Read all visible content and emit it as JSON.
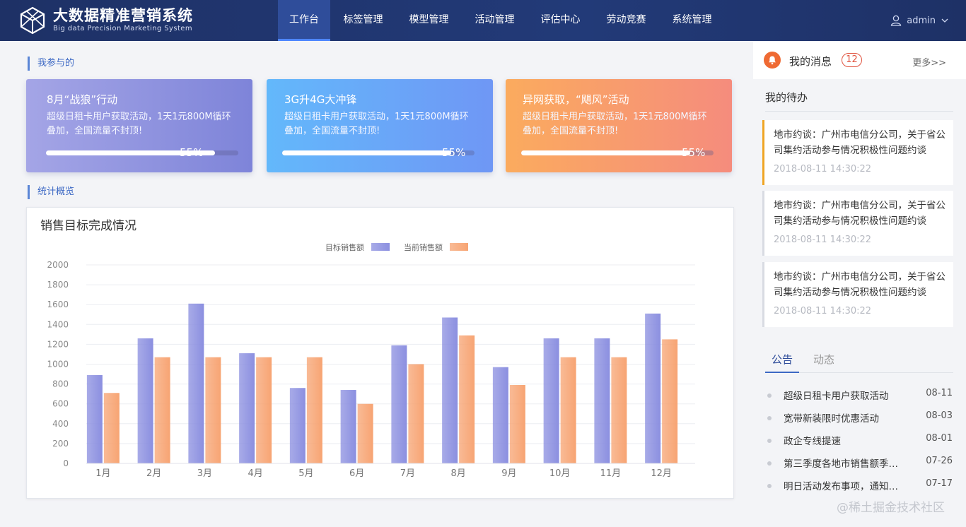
{
  "brand": {
    "title": "大数据精准营销系统",
    "subtitle": "Big data Precision Marketing System"
  },
  "nav": {
    "items": [
      {
        "label": "工作台",
        "active": true
      },
      {
        "label": "标签管理"
      },
      {
        "label": "模型管理"
      },
      {
        "label": "活动管理"
      },
      {
        "label": "评估中心"
      },
      {
        "label": "劳动竞赛"
      },
      {
        "label": "系统管理"
      }
    ]
  },
  "user": {
    "name": "admin",
    "icon": "user-icon",
    "dropdown_icon": "chevron-down-icon"
  },
  "sections": {
    "participated": "我参与的",
    "overview": "统计概览"
  },
  "cards": [
    {
      "title": "8月“战狼”行动",
      "desc": "超级日租卡用户获取活动，1天1元800M循环叠加，全国流量不封顶!",
      "progress": 55,
      "progress_label": "55%",
      "colors": [
        "#a4a5e6",
        "#7e84d9"
      ]
    },
    {
      "title": "3G升4G大冲锋",
      "desc": "超级日租卡用户获取活动，1天1元800M循环叠加，全国流量不封顶!",
      "progress": 55,
      "progress_label": "55%",
      "colors": [
        "#63b8fb",
        "#6f97f5"
      ]
    },
    {
      "title": "异网获取，“飓风”活动",
      "desc": "超级日租卡用户获取活动，1天1元800M循环叠加，全国流量不封顶!",
      "progress": 55,
      "progress_label": "55%",
      "colors": [
        "#fbab5e",
        "#f58c7d"
      ]
    }
  ],
  "chart_panel": {
    "title": "销售目标完成情况"
  },
  "chart_data": {
    "type": "bar",
    "categories": [
      "1月",
      "2月",
      "3月",
      "4月",
      "5月",
      "6月",
      "7月",
      "8月",
      "9月",
      "10月",
      "11月",
      "12月"
    ],
    "series": [
      {
        "name": "目标销售额",
        "values": [
          890,
          1260,
          1610,
          1110,
          760,
          740,
          1190,
          1470,
          970,
          1260,
          1260,
          1510
        ],
        "color": "#8b8fe0"
      },
      {
        "name": "当前销售额",
        "values": [
          710,
          1070,
          1070,
          1070,
          1070,
          600,
          1000,
          1290,
          790,
          1070,
          1070,
          1250
        ],
        "color": "#f7a473"
      }
    ],
    "title": "",
    "xlabel": "",
    "ylabel": "",
    "ylim": [
      0,
      2000
    ],
    "yticks": [
      0,
      200,
      400,
      600,
      800,
      1000,
      1200,
      1400,
      1600,
      1800,
      2000
    ],
    "grid": true,
    "legend_position": "top-center"
  },
  "messages": {
    "icon": "bell-icon",
    "title": "我的消息",
    "count": "12",
    "more": "更多>>"
  },
  "todo": {
    "title": "我的待办",
    "items": [
      {
        "text": "地市约谈：广州市电信分公司，关于省公司集约活动参与情况积极性问题约谈",
        "time": "2018-08-11  14:30:22",
        "active": true
      },
      {
        "text": "地市约谈：广州市电信分公司，关于省公司集约活动参与情况积极性问题约谈",
        "time": "2018-08-11  14:30:22"
      },
      {
        "text": "地市约谈：广州市电信分公司，关于省公司集约活动参与情况积极性问题约谈",
        "time": "2018-08-11  14:30:22"
      }
    ]
  },
  "notice_tabs": [
    {
      "label": "公告",
      "active": true
    },
    {
      "label": "动态"
    }
  ],
  "notices": [
    {
      "title": "超级日租卡用户获取活动",
      "date": "08-11"
    },
    {
      "title": "宽带新装限时优惠活动",
      "date": "08-03"
    },
    {
      "title": "政企专线提速",
      "date": "08-01"
    },
    {
      "title": "第三季度各地市销售额季度汇总",
      "date": "07-26"
    },
    {
      "title": "明日活动发布事项，通知各地市",
      "date": "07-17"
    }
  ],
  "watermark": "@稀土掘金技术社区"
}
